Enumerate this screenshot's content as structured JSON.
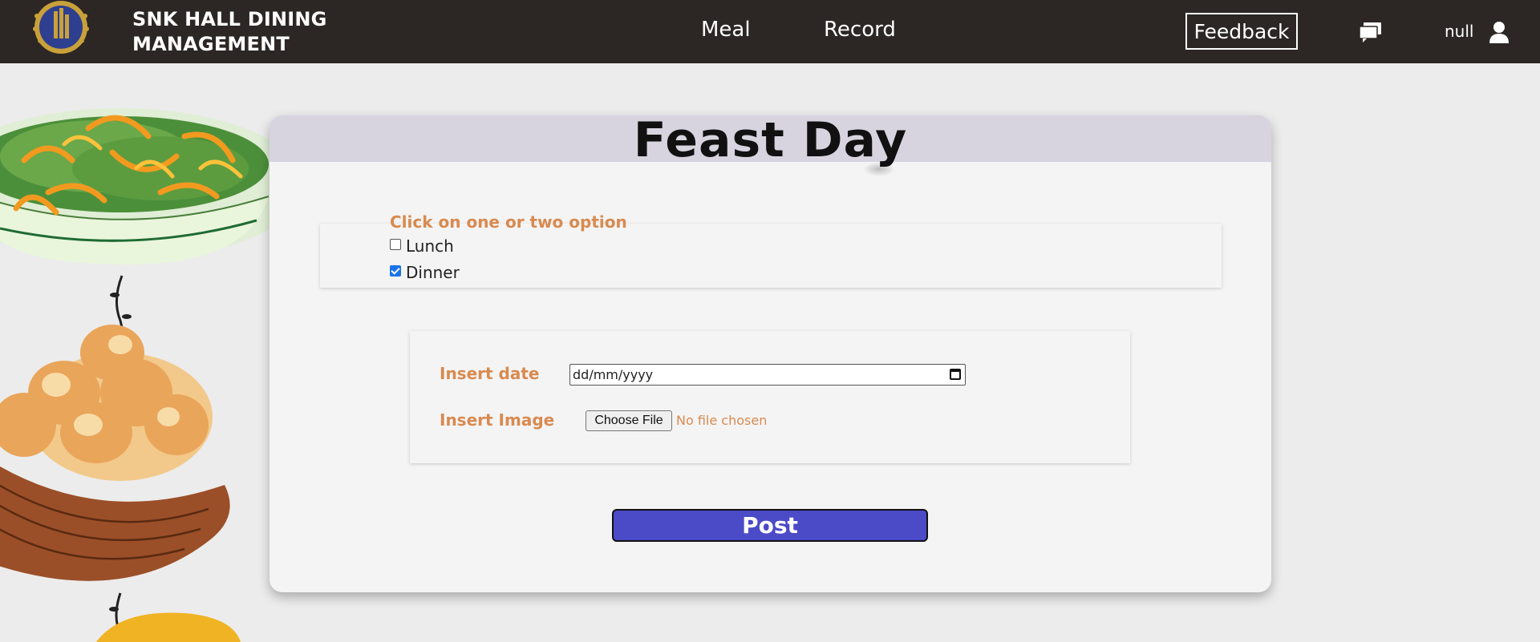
{
  "navbar": {
    "brand_line1": "SNK HALL DINING",
    "brand_line2": "MANAGEMENT",
    "links": [
      "Meal",
      "Record"
    ],
    "feedback_label": "Feedback",
    "username": "null",
    "icons": [
      "logo",
      "chat-icon",
      "user-icon"
    ]
  },
  "card": {
    "title": "Feast Day",
    "options_label": "Click on one or two option",
    "options": [
      {
        "label": "Lunch",
        "checked": false
      },
      {
        "label": "Dinner",
        "checked": true
      }
    ],
    "date_label": "Insert date",
    "date_placeholder": "dd/mm/yyyy",
    "image_label": "Insert Image",
    "file_button": "Choose File",
    "file_status": "No file chosen",
    "post_label": "Post"
  },
  "colors": {
    "navbar_bg": "#2c2624",
    "header_bg": "#d7d4e0",
    "accent_orange": "#d88a4f",
    "post_button": "#4b4ac7",
    "page_bg": "#ececec"
  }
}
